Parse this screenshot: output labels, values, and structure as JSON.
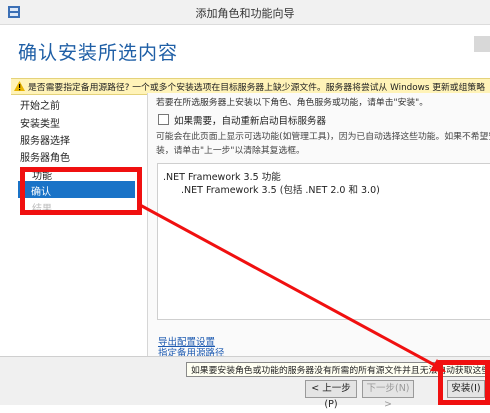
{
  "window": {
    "title": "添加角色和功能向导"
  },
  "header": {
    "title": "确认安装所选内容"
  },
  "warning": {
    "text": "是否需要指定备用源路径? 一个或多个安装选项在目标服务器上缺少源文件。服务器将尝试从 Windows 更新或组策略"
  },
  "sidebar": {
    "items": [
      "开始之前",
      "安装类型",
      "服务器选择",
      "服务器角色",
      "功能",
      "确认",
      "结果"
    ],
    "selected": "确认"
  },
  "main": {
    "intro": "若要在所选服务器上安装以下角色、角色服务或功能，请单击\"安装\"。",
    "restart_checkbox": {
      "label": "如果需要，自动重新启动目标服务器",
      "checked": false
    },
    "note_line1": "可能会在此页面上显示可选功能(如管理工具)，因为已自动选择这些功能。如果不希望安",
    "note_line2": "装，请单击\"上一步\"以清除其复选框。",
    "features": [
      ".NET Framework 3.5 功能",
      ".NET Framework 3.5 (包括 .NET 2.0 和 3.0)"
    ],
    "links": {
      "export": "导出配置设置",
      "alt_source": "指定备用源路径"
    }
  },
  "tooltip": {
    "text": "如果要安装角色或功能的服务器没有所需的所有源文件并且无法自动获取这些"
  },
  "footer": {
    "prev_label": "< 上一步(P)",
    "next_label": "下一步(N) >",
    "install_label": "安装(I)"
  },
  "colors": {
    "accent": "#1a73c7",
    "highlight": "#f01010",
    "warning_bg": "#fff3b8"
  }
}
